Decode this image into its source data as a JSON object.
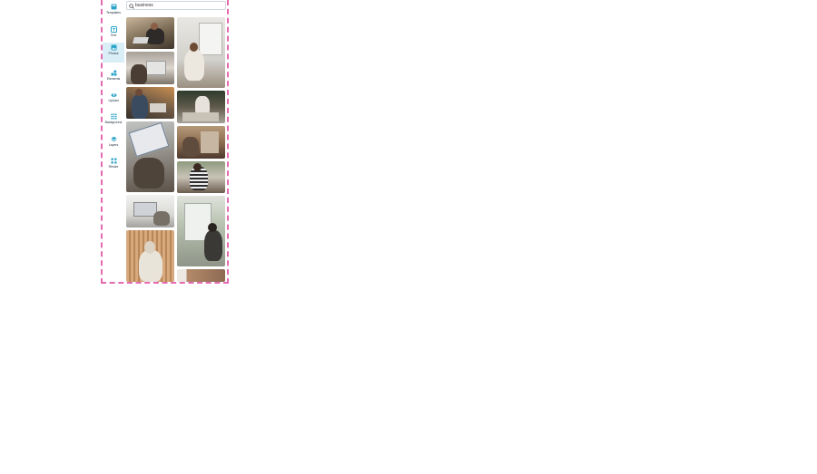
{
  "sidebar": {
    "items": [
      {
        "label": "Templates",
        "icon": "templates-icon"
      },
      {
        "label": "Text",
        "icon": "text-icon"
      },
      {
        "label": "Photos",
        "icon": "photos-icon"
      },
      {
        "label": "Elements",
        "icon": "elements-icon"
      },
      {
        "label": "Upload",
        "icon": "upload-icon"
      },
      {
        "label": "Background",
        "icon": "background-icon"
      },
      {
        "label": "Layers",
        "icon": "layers-icon"
      },
      {
        "label": "Resize",
        "icon": "resize-icon"
      }
    ],
    "active": "Photos"
  },
  "search": {
    "value": "business",
    "icon": "search-icon"
  },
  "colors": {
    "accent": "#2ba3c9",
    "active_bg": "#d9eef7",
    "frame_border": "#e46ab2"
  }
}
